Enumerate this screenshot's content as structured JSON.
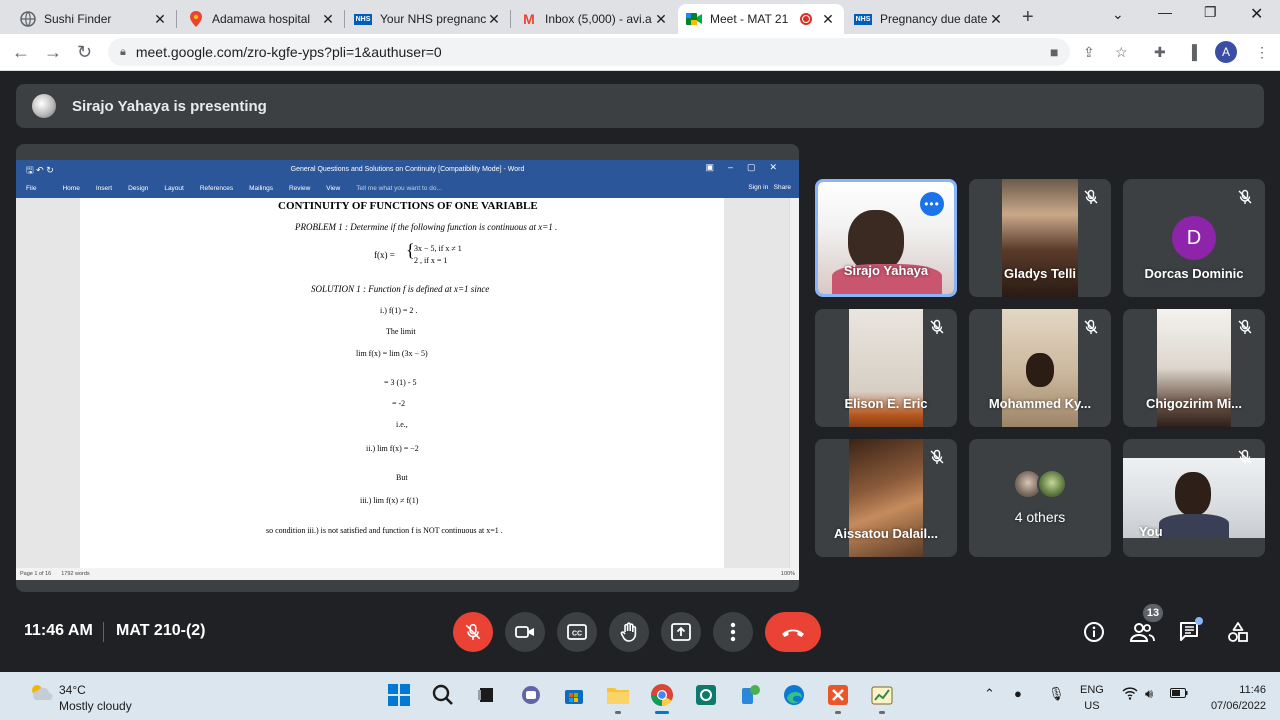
{
  "browser": {
    "tabs": [
      {
        "title": "Sushi Finder",
        "favicon": "globe-icon"
      },
      {
        "title": "Adamawa hospital",
        "favicon": "maps-pin-icon"
      },
      {
        "title": "Your NHS pregnanc",
        "favicon": "nhs-icon"
      },
      {
        "title": "Inbox (5,000) - avi.a",
        "favicon": "gmail-icon"
      },
      {
        "title": "Meet - MAT 21",
        "favicon": "meet-icon",
        "active": true,
        "recording": true
      },
      {
        "title": "Pregnancy due date",
        "favicon": "nhs-icon"
      }
    ],
    "url": "meet.google.com/zro-kgfe-yps?pli=1&authuser=0",
    "profile_initial": "A"
  },
  "meet": {
    "presenting_text": "Sirajo Yahaya is presenting",
    "clock": "11:46 AM",
    "meeting_code": "MAT 210-(2)",
    "participant_badge": "13",
    "participants": [
      {
        "name": "Sirajo Yahaya",
        "active_speaker": true
      },
      {
        "name": "Gladys Telli",
        "muted": true
      },
      {
        "name": "Dorcas Dominic",
        "muted": true,
        "initial": "D"
      },
      {
        "name": "Elison E. Eric",
        "muted": true
      },
      {
        "name": "Mohammed Ky...",
        "muted": true
      },
      {
        "name": "Chigozirim Mi...",
        "muted": true
      },
      {
        "name": "Aissatou Dalail...",
        "muted": true
      },
      {
        "name": "4 others"
      },
      {
        "name": "You",
        "muted": true
      }
    ],
    "accent_red": "#ea4335",
    "accent_blue": "#8ab4f8"
  },
  "word": {
    "title": "General Questions and Solutions on Continuity [Compatibility Mode] - Word",
    "ribbon_tabs": [
      "File",
      "Home",
      "Insert",
      "Design",
      "Layout",
      "References",
      "Mailings",
      "Review",
      "View"
    ],
    "tell_me": "Tell me what you want to do...",
    "sign_in": "Sign in",
    "share": "Share",
    "status_page": "Page 1 of 16",
    "status_words": "1792 words",
    "zoom": "100%",
    "doc": {
      "heading": "CONTINUITY OF FUNCTIONS OF ONE VARIABLE",
      "problem": "PROBLEM 1 : Determine if the following function is continuous at x=1 .",
      "fx_lhs": "f(x) =",
      "case1": "3x − 5,   if x ≠ 1",
      "case2": "2 ,    if x = 1",
      "solution": "SOLUTION 1 : Function f is defined at x=1 since",
      "step_i": "i.) f(1) = 2 .",
      "the_limit": "The limit",
      "lim_line": "lim f(x) = lim (3x − 5)",
      "eq1": "= 3 (1) - 5",
      "eq2": "= -2",
      "ie": "i.e.,",
      "step_ii": "ii.)  lim f(x) = −2",
      "but": "But",
      "step_iii": "iii.)  lim f(x) ≠ f(1)",
      "conclusion": "so condition iii.) is not satisfied and function f is NOT continuous at x=1 ."
    }
  },
  "taskbar": {
    "temperature": "34°C",
    "weather": "Mostly cloudy",
    "lang_top": "ENG",
    "lang_bottom": "US",
    "time": "11:46",
    "date": "07/06/2022"
  }
}
